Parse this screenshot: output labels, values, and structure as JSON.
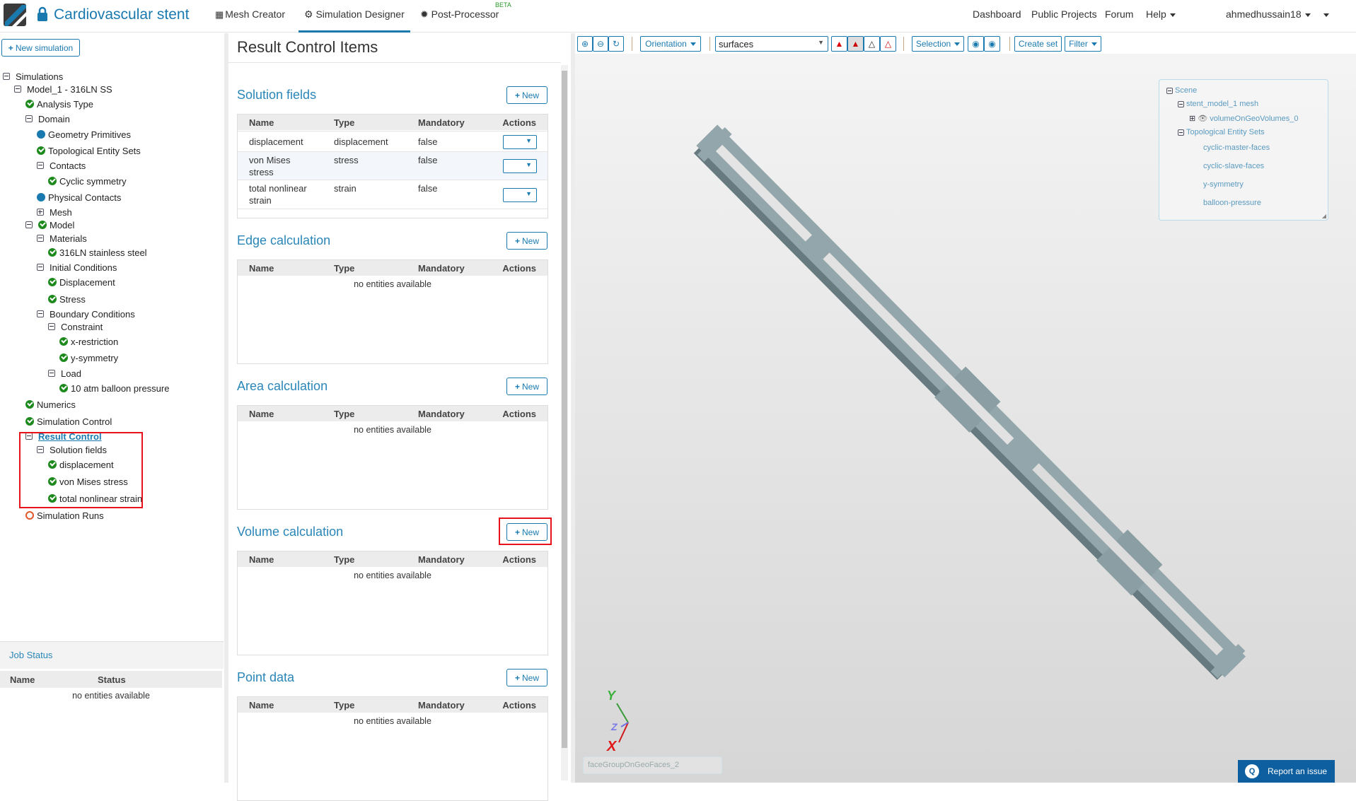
{
  "header": {
    "title": "Cardiovascular stent",
    "nav": [
      {
        "label": "Mesh Creator",
        "icon": "grid-icon"
      },
      {
        "label": "Simulation Designer",
        "icon": "gears-icon",
        "active": true
      },
      {
        "label": "Post-Processor",
        "icon": "gear-icon",
        "badge": "BETA"
      }
    ],
    "right": [
      "Dashboard",
      "Public Projects",
      "Forum",
      "Help"
    ],
    "user": "ahmedhussain18"
  },
  "left": {
    "new_simulation": "New simulation",
    "tree": [
      {
        "label": "Simulations",
        "level": 0,
        "icon": "minus"
      },
      {
        "label": "Model_1 - 316LN SS",
        "level": 1,
        "icon": "minus"
      },
      {
        "label": "Analysis Type",
        "level": 2,
        "icon": "check"
      },
      {
        "label": "Domain",
        "level": 2,
        "icon": "minus"
      },
      {
        "label": "Geometry Primitives",
        "level": 3,
        "icon": "dot"
      },
      {
        "label": "Topological Entity Sets",
        "level": 3,
        "icon": "check"
      },
      {
        "label": "Contacts",
        "level": 3,
        "icon": "minus"
      },
      {
        "label": "Cyclic symmetry",
        "level": 4,
        "icon": "check"
      },
      {
        "label": "Physical Contacts",
        "level": 3,
        "icon": "dot"
      },
      {
        "label": "Mesh",
        "level": 3,
        "icon": "plus"
      },
      {
        "label": "Model",
        "level": 2,
        "icon": "minus-check"
      },
      {
        "label": "Materials",
        "level": 3,
        "icon": "minus"
      },
      {
        "label": "316LN stainless steel",
        "level": 4,
        "icon": "check"
      },
      {
        "label": "Initial Conditions",
        "level": 3,
        "icon": "minus"
      },
      {
        "label": "Displacement",
        "level": 4,
        "icon": "check"
      },
      {
        "label": "Stress",
        "level": 4,
        "icon": "check"
      },
      {
        "label": "Boundary Conditions",
        "level": 3,
        "icon": "minus"
      },
      {
        "label": "Constraint",
        "level": 4,
        "icon": "minus"
      },
      {
        "label": "x-restriction",
        "level": 5,
        "icon": "check"
      },
      {
        "label": "y-symmetry",
        "level": 5,
        "icon": "check"
      },
      {
        "label": "Load",
        "level": 4,
        "icon": "minus"
      },
      {
        "label": "10 atm balloon pressure",
        "level": 5,
        "icon": "check"
      },
      {
        "label": "Numerics",
        "level": 2,
        "icon": "check"
      },
      {
        "label": "Simulation Control",
        "level": 2,
        "icon": "check"
      },
      {
        "label": "Result Control",
        "level": 2,
        "icon": "minus",
        "link": true
      },
      {
        "label": "Solution fields",
        "level": 3,
        "icon": "minus"
      },
      {
        "label": "displacement",
        "level": 4,
        "icon": "check"
      },
      {
        "label": "von Mises stress",
        "level": 4,
        "icon": "check"
      },
      {
        "label": "total nonlinear strain",
        "level": 4,
        "icon": "check"
      },
      {
        "label": "Simulation Runs",
        "level": 2,
        "icon": "ring"
      }
    ],
    "job_status": {
      "title": "Job Status",
      "columns": [
        "Name",
        "Status"
      ],
      "empty": "no entities available"
    }
  },
  "main": {
    "title": "Result Control Items",
    "new_label": "New",
    "columns": [
      "Name",
      "Type",
      "Mandatory",
      "Actions"
    ],
    "empty": "no entities available",
    "sections": [
      {
        "title": "Solution fields",
        "rows": [
          [
            "displacement",
            "displacement",
            "false"
          ],
          [
            "von Mises stress",
            "stress",
            "false"
          ],
          [
            "total nonlinear strain",
            "strain",
            "false"
          ]
        ]
      },
      {
        "title": "Edge calculation",
        "rows": []
      },
      {
        "title": "Area calculation",
        "rows": []
      },
      {
        "title": "Volume calculation",
        "rows": []
      },
      {
        "title": "Point data",
        "rows": []
      }
    ]
  },
  "viewer": {
    "orientation": "Orientation",
    "representation": "surfaces",
    "selection": "Selection",
    "create_set": "Create set",
    "filter": "Filter",
    "scene": {
      "root": "Scene",
      "mesh": "stent_model_1 mesh",
      "volume": "volumeOnGeoVolumes_0",
      "sets_title": "Topological Entity Sets",
      "sets": [
        "cyclic-master-faces",
        "cyclic-slave-faces",
        "y-symmetry",
        "balloon-pressure"
      ]
    },
    "axes": {
      "x": "X",
      "y": "Y",
      "z": "Z"
    },
    "selected_entity": "faceGroupOnGeoFaces_2",
    "report": "Report an issue"
  }
}
